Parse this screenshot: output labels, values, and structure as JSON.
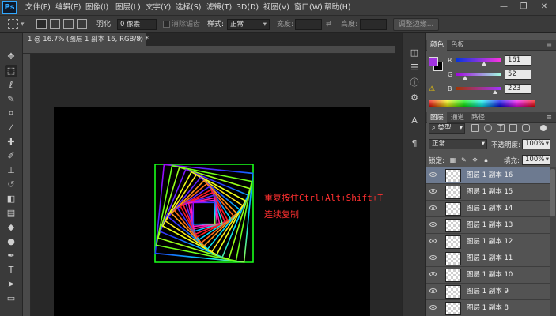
{
  "app": {
    "logo": "Ps",
    "menu": [
      "文件(F)",
      "编辑(E)",
      "图像(I)",
      "图层(L)",
      "文字(Y)",
      "选择(S)",
      "滤镜(T)",
      "3D(D)",
      "视图(V)",
      "窗口(W)",
      "帮助(H)"
    ],
    "window_controls": [
      "—",
      "❐",
      "✕"
    ]
  },
  "options": {
    "feather_label": "羽化:",
    "feather_value": "0 像素",
    "antialias_label": "消除锯齿",
    "style_label": "样式:",
    "style_value": "正常",
    "width_label": "宽度:",
    "height_label": "高度:",
    "refine_edge_button": "调整边缘..."
  },
  "document": {
    "tab_title": "1 @ 16.7% (图层 1 副本 16, RGB/8) *",
    "tab_close": "×",
    "annotation_line1": "重复按住Ctrl+Alt+Shift+T",
    "annotation_line2": "连续复制"
  },
  "color_panel": {
    "tabs": [
      "颜色",
      "色板"
    ],
    "foreground": "#a134df",
    "channels": [
      {
        "label": "R",
        "value": "161"
      },
      {
        "label": "G",
        "value": "52"
      },
      {
        "label": "B",
        "value": "223"
      }
    ]
  },
  "layers_panel": {
    "tabs": [
      "图层",
      "通道",
      "路径"
    ],
    "filter_kind": "类型",
    "blend_mode": "正常",
    "opacity_label": "不透明度:",
    "opacity_value": "100%",
    "lock_label": "锁定:",
    "fill_label": "填充:",
    "fill_value": "100%",
    "layers": [
      {
        "name": "图层 1 副本 16",
        "selected": true
      },
      {
        "name": "图层 1 副本 15",
        "selected": false
      },
      {
        "name": "图层 1 副本 14",
        "selected": false
      },
      {
        "name": "图层 1 副本 13",
        "selected": false
      },
      {
        "name": "图层 1 副本 12",
        "selected": false
      },
      {
        "name": "图层 1 副本 11",
        "selected": false
      },
      {
        "name": "图层 1 副本 10",
        "selected": false
      },
      {
        "name": "图层 1 副本 9",
        "selected": false
      },
      {
        "name": "图层 1 副本 8",
        "selected": false
      }
    ]
  }
}
